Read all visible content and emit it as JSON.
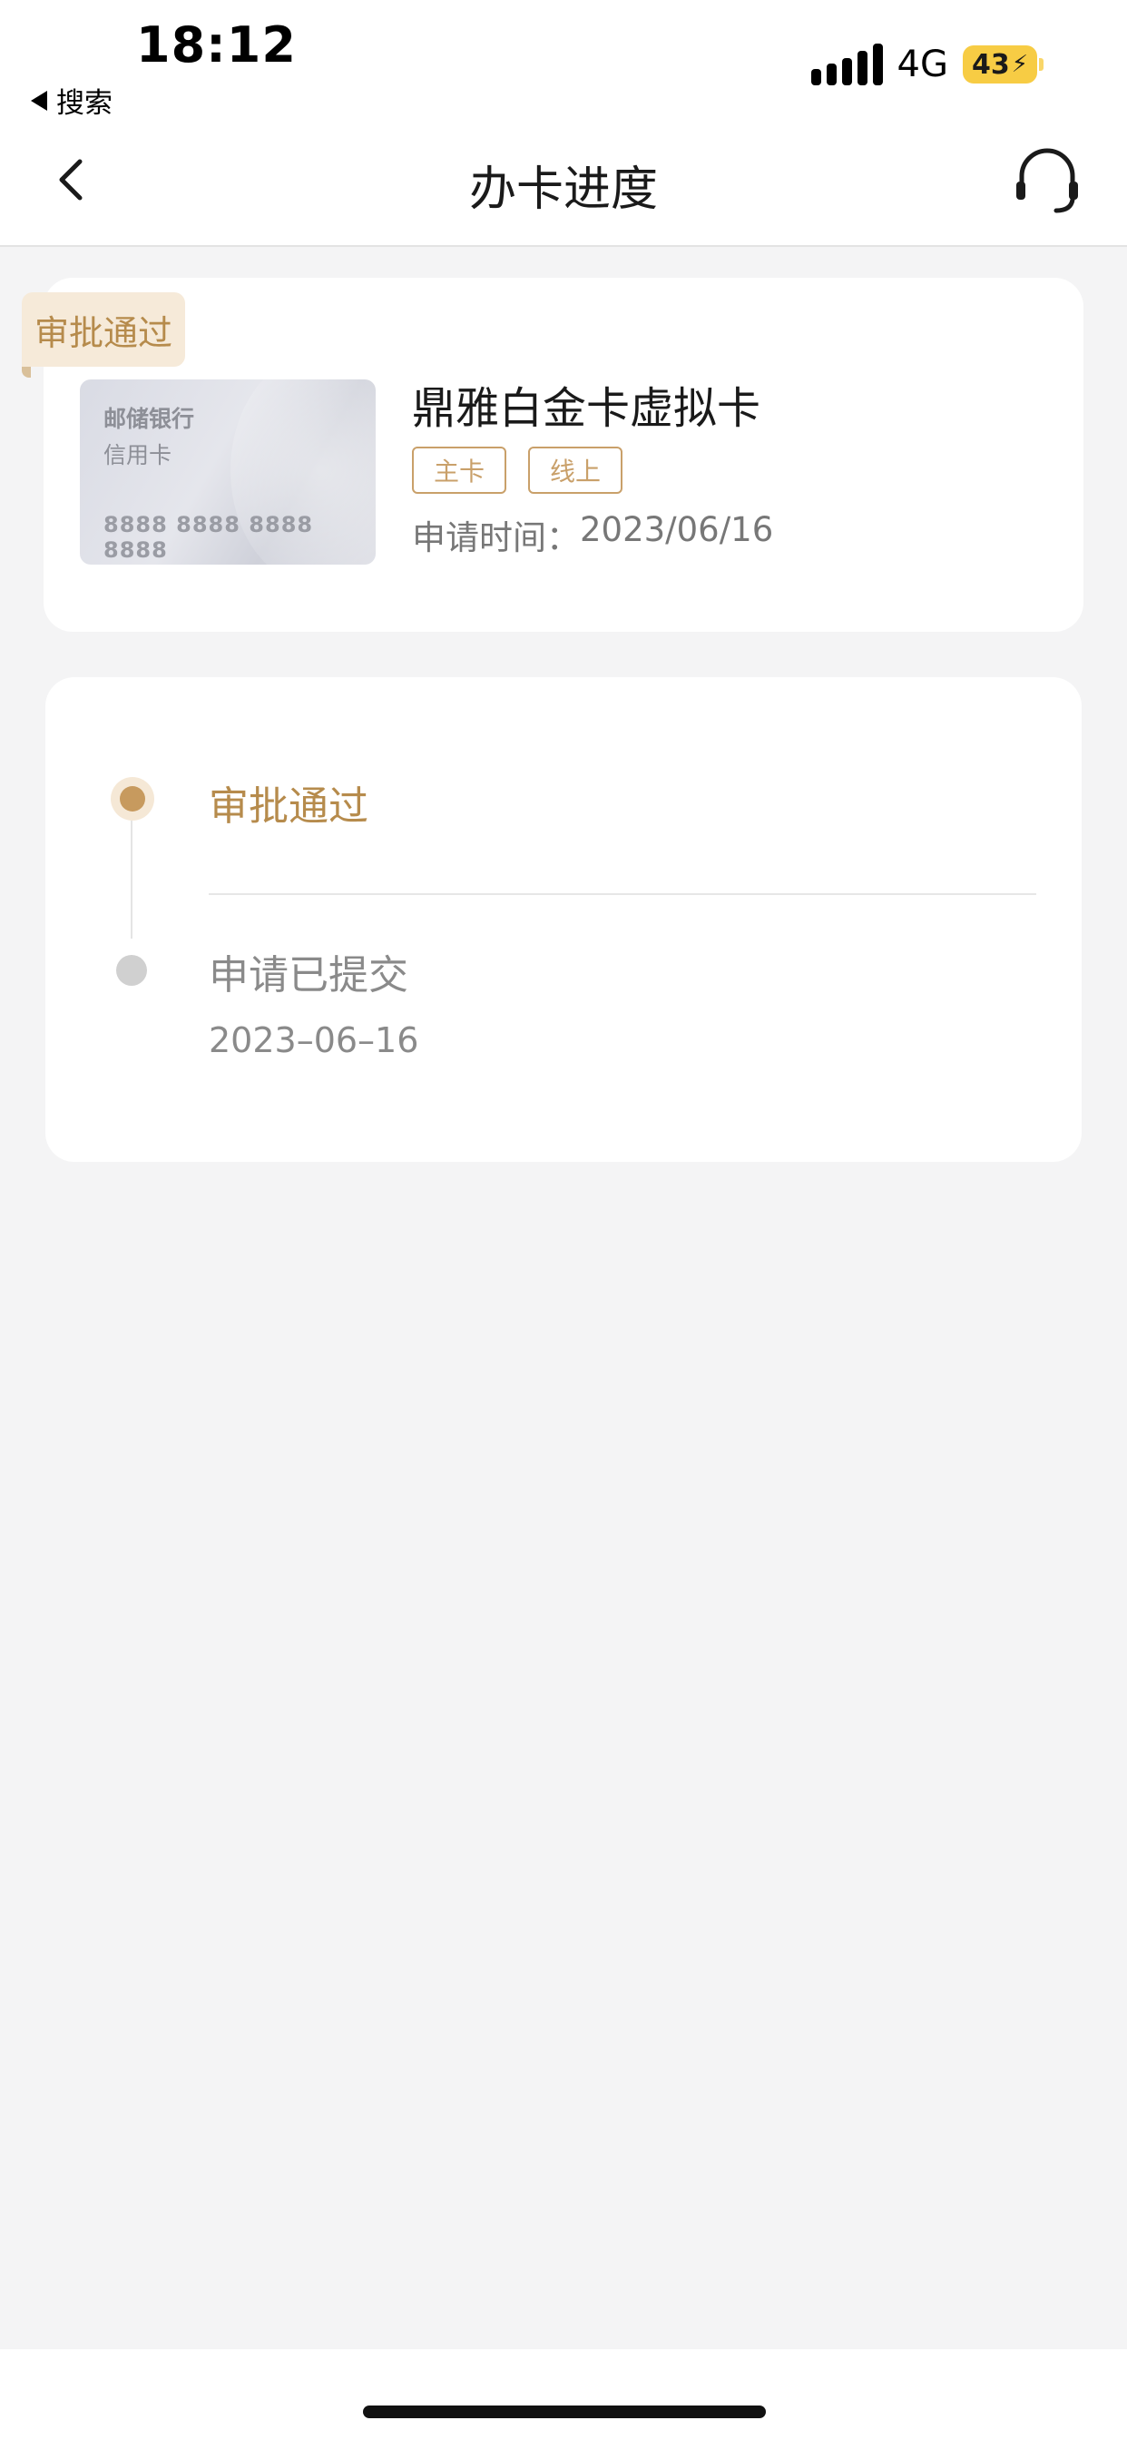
{
  "status_bar": {
    "time": "18:12",
    "back_app": "搜索",
    "network": "4G",
    "battery": "43"
  },
  "nav": {
    "title": "办卡进度",
    "back_icon": "chevron-left-icon",
    "service_icon": "headset-icon"
  },
  "card": {
    "status_tag": "审批通过",
    "image": {
      "bank": "邮储银行",
      "type": "信用卡",
      "number": "8888 8888 8888 8888"
    },
    "name": "鼎雅白金卡虚拟卡",
    "tags": [
      "主卡",
      "线上"
    ],
    "apply_time_label": "申请时间：",
    "apply_time": "2023/06/16"
  },
  "timeline": {
    "steps": [
      {
        "label": "审批通过",
        "date": ""
      },
      {
        "label": "申请已提交",
        "date": "2023–06–16"
      }
    ]
  },
  "colors": {
    "accent": "#c79a5e",
    "accent_text": "#b68b4c",
    "background": "#f4f4f5",
    "battery": "#f7cc44"
  }
}
